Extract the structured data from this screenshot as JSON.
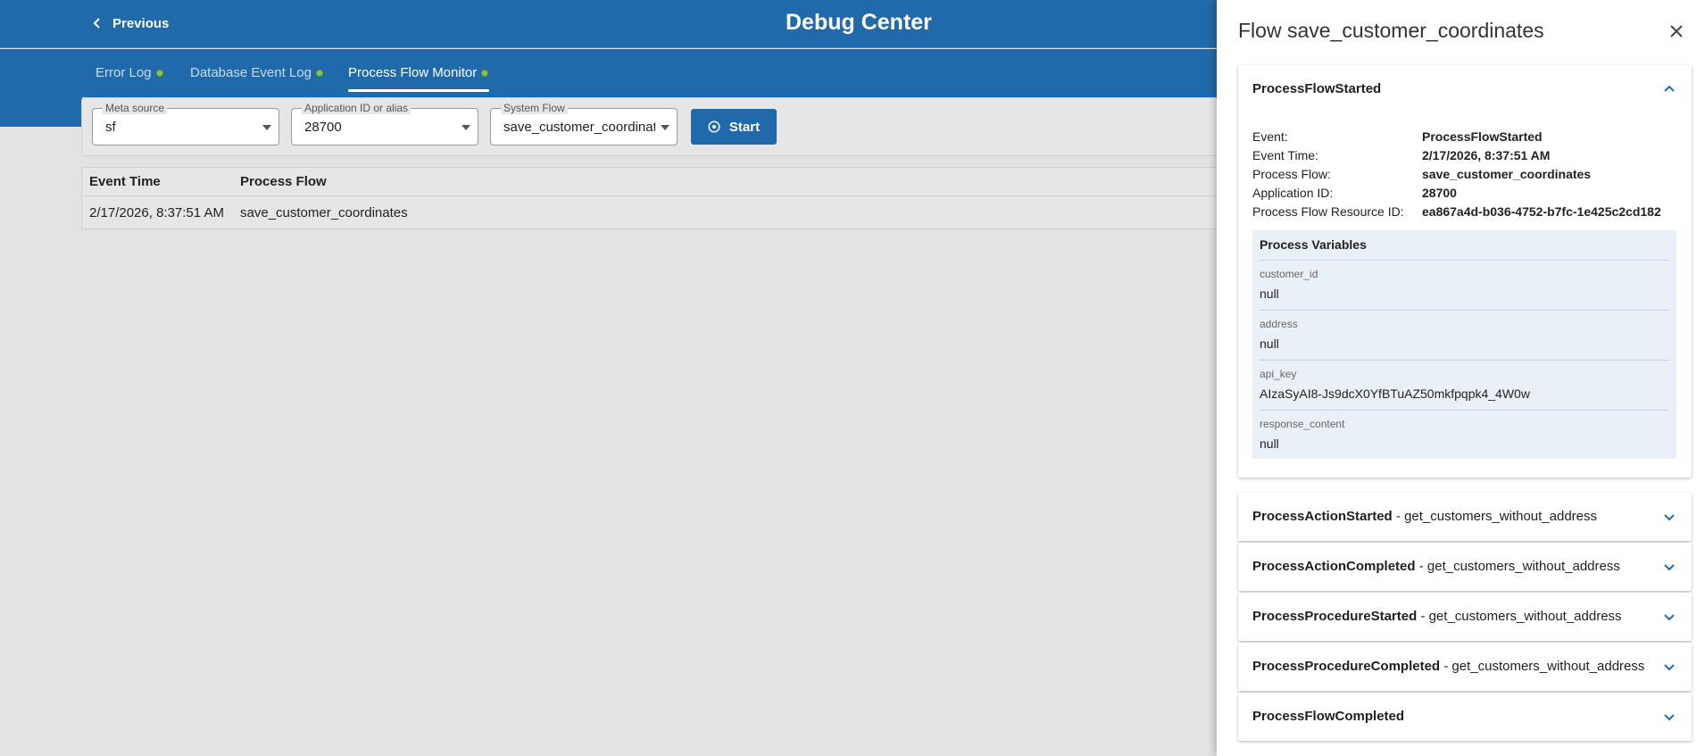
{
  "header": {
    "previous_label": "Previous",
    "title": "Debug Center"
  },
  "tabs": [
    {
      "label": "Error Log",
      "active": false
    },
    {
      "label": "Database Event Log",
      "active": false
    },
    {
      "label": "Process Flow Monitor",
      "active": true
    }
  ],
  "filters": {
    "meta_source": {
      "label": "Meta source",
      "value": "sf"
    },
    "application": {
      "label": "Application ID or alias",
      "value": "28700"
    },
    "system_flow": {
      "label": "System Flow",
      "value": "save_customer_coordinates"
    },
    "start_label": "Start"
  },
  "table": {
    "columns": [
      "Event Time",
      "Process Flow"
    ],
    "rows": [
      {
        "event_time": "2/17/2026, 8:37:51 AM",
        "process_flow": "save_customer_coordinates"
      }
    ]
  },
  "panel": {
    "title": "Flow save_customer_coordinates",
    "expanded": {
      "title": "ProcessFlowStarted",
      "fields": [
        {
          "key": "Event:",
          "value": "ProcessFlowStarted"
        },
        {
          "key": "Event Time:",
          "value": "2/17/2026, 8:37:51 AM"
        },
        {
          "key": "Process Flow:",
          "value": "save_customer_coordinates"
        },
        {
          "key": "Application ID:",
          "value": "28700"
        },
        {
          "key": "Process Flow Resource ID:",
          "value": "ea867a4d-b036-4752-b7fc-1e425c2cd182"
        }
      ],
      "variables_title": "Process Variables",
      "variables": [
        {
          "key": "customer_id",
          "value": "null"
        },
        {
          "key": "address",
          "value": "null"
        },
        {
          "key": "api_key",
          "value": "AIzaSyAI8-Js9dcX0YfBTuAZ50mkfpqpk4_4W0w"
        },
        {
          "key": "response_content",
          "value": "null"
        }
      ]
    },
    "collapsed": [
      {
        "event": "ProcessActionStarted",
        "sep": " - ",
        "detail": "get_customers_without_address"
      },
      {
        "event": "ProcessActionCompleted",
        "sep": " - ",
        "detail": "get_customers_without_address"
      },
      {
        "event": "ProcessProcedureStarted",
        "sep": " - ",
        "detail": "get_customers_without_address"
      },
      {
        "event": "ProcessProcedureCompleted",
        "sep": " - ",
        "detail": "get_customers_without_address"
      },
      {
        "event": "ProcessFlowCompleted",
        "sep": "",
        "detail": ""
      }
    ]
  },
  "colors": {
    "primary": "#2069aa",
    "status_dot": "#8bc34a",
    "variables_bg": "#eaf0f8"
  }
}
